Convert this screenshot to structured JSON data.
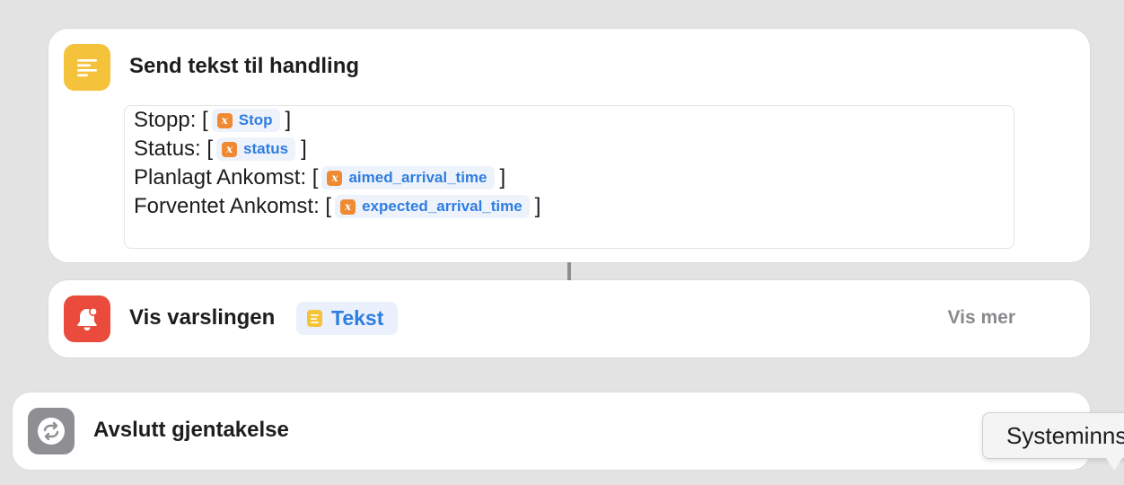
{
  "send_action": {
    "icon": "text-lines-icon",
    "icon_color": "#f5c33b",
    "title": "Send tekst til handling",
    "lines": [
      {
        "label": "Stopp: [",
        "variable": "Stop",
        "close": "]"
      },
      {
        "label": "Status: [",
        "variable": "status",
        "close": "]"
      },
      {
        "label": "Planlagt Ankomst: [",
        "variable": "aimed_arrival_time",
        "close": "]"
      },
      {
        "label": "Forventet Ankomst: [",
        "variable": "expected_arrival_time",
        "close": "]"
      }
    ],
    "variable_icon_glyph": "x"
  },
  "notify_action": {
    "icon": "bell-icon",
    "icon_color": "#ea4b3d",
    "title": "Vis varslingen",
    "pill_label": "Tekst",
    "more_label": "Vis mer"
  },
  "end_action": {
    "icon": "repeat-icon",
    "icon_color": "#8e8e93",
    "title": "Avslutt gjentakelse"
  },
  "tooltip": {
    "text": "Systeminnstillinger"
  },
  "colors": {
    "background": "#e3e3e3",
    "card": "#ffffff",
    "token_text": "#2f7de1",
    "variable_chip": "#ef8a33"
  }
}
